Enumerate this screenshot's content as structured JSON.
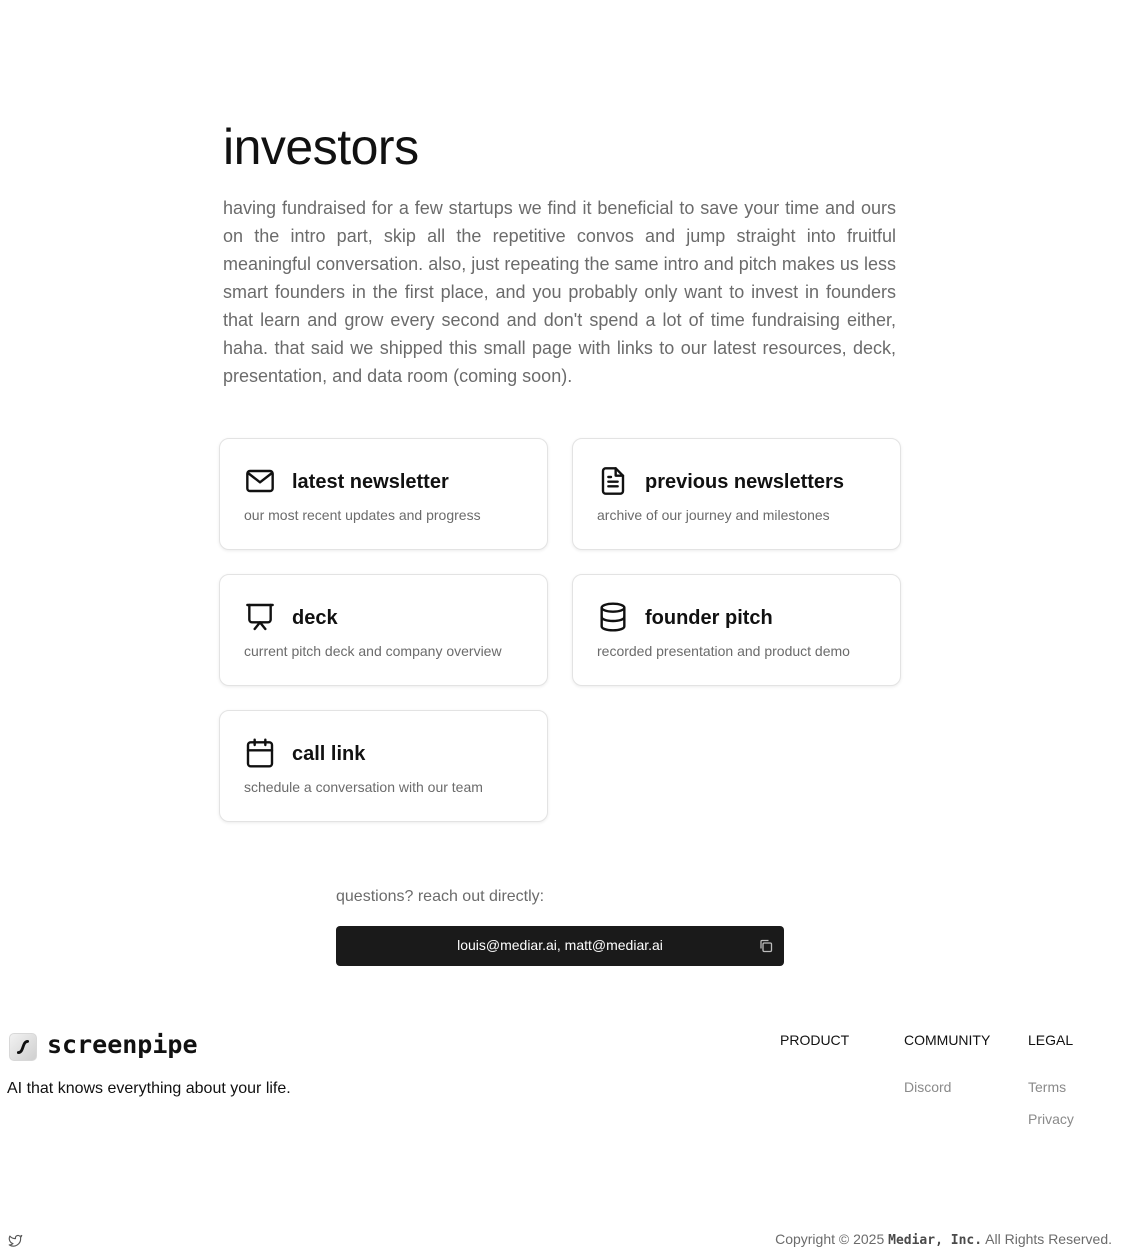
{
  "page": {
    "title": "investors",
    "intro": "having fundraised for a few startups we find it beneficial to save your time and ours on the intro part, skip all the repetitive convos and jump straight into fruitful meaningful conversation. also, just repeating the same intro and pitch makes us less smart founders in the first place, and you probably only want to invest in founders that learn and grow every second and don't spend a lot of time fundraising either, haha. that said we shipped this small page with links to our latest resources, deck, presentation, and data room (coming soon)."
  },
  "cards": [
    {
      "icon": "mail-icon",
      "title": "latest newsletter",
      "description": "our most recent updates and progress"
    },
    {
      "icon": "document-icon",
      "title": "previous newsletters",
      "description": "archive of our journey and milestones"
    },
    {
      "icon": "presentation-icon",
      "title": "deck",
      "description": "current pitch deck and company overview"
    },
    {
      "icon": "database-icon",
      "title": "founder pitch",
      "description": "recorded presentation and product demo"
    },
    {
      "icon": "calendar-icon",
      "title": "call link",
      "description": "schedule a conversation with our team"
    }
  ],
  "contact": {
    "prompt": "questions? reach out directly:",
    "emails": "louis@mediar.ai, matt@mediar.ai",
    "copy_icon": "copy-icon"
  },
  "footer": {
    "brand": "screenpipe",
    "tagline": "AI that knows everything about your life.",
    "columns": [
      {
        "heading": "PRODUCT",
        "links": []
      },
      {
        "heading": "COMMUNITY",
        "links": [
          "Discord"
        ]
      },
      {
        "heading": "LEGAL",
        "links": [
          "Terms",
          "Privacy"
        ]
      }
    ],
    "social_icon": "twitter-icon",
    "copyright_prefix": "Copyright © 2025",
    "company": "Mediar, Inc.",
    "copyright_suffix": "All Rights Reserved."
  }
}
